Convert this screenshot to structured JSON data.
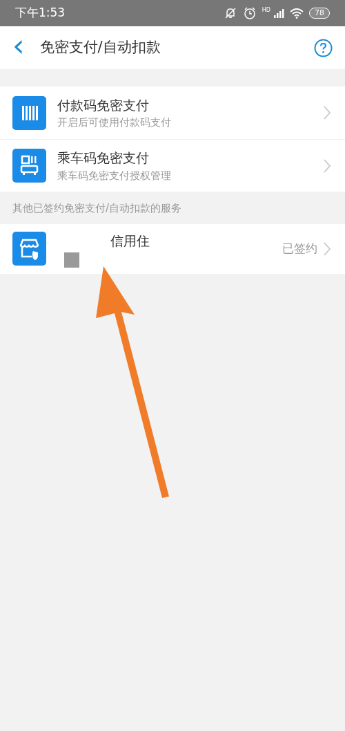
{
  "status_bar": {
    "time": "下午1:53",
    "network_tag": "HD",
    "battery": "78"
  },
  "header": {
    "back": "‹",
    "title": "免密支付/自动扣款"
  },
  "items": [
    {
      "title": "付款码免密支付",
      "subtitle": "开启后可使用付款码支付"
    },
    {
      "title": "乘车码免密支付",
      "subtitle": "乘车码免密支付授权管理"
    }
  ],
  "section": {
    "title": "其他已签约免密支付/自动扣款的服务"
  },
  "services": [
    {
      "title": "信用住",
      "status": "已签约"
    }
  ]
}
